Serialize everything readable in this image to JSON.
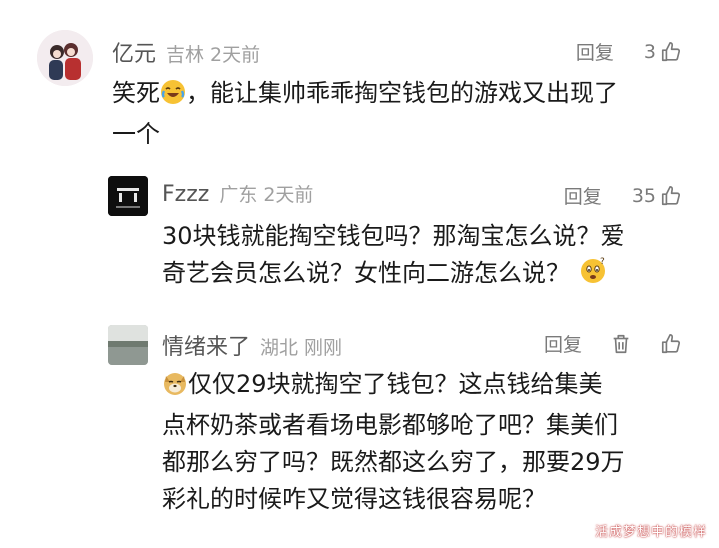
{
  "comments": [
    {
      "username": "亿元",
      "location": "吉林",
      "time": "2天前",
      "reply_label": "回复",
      "likes": "3",
      "text_lines": [
        "笑死",
        "，能让集帅乖乖掏空钱包的游戏又出现了",
        "一个"
      ]
    },
    {
      "username": "Fzzz",
      "location": "广东",
      "time": "2天前",
      "reply_label": "回复",
      "likes": "35",
      "text_lines": [
        "30块钱就能掏空钱包吗？那淘宝怎么说？爱",
        "奇艺会员怎么说？女性向二游怎么说？"
      ]
    },
    {
      "username": "情绪来了",
      "location": "湖北",
      "time": "刚刚",
      "reply_label": "回复",
      "text_lines": [
        "仅仅29块就掏空了钱包？这点钱给集美",
        "点杯奶茶或者看场电影都够呛了吧？集美们",
        "都那么穷了吗？既然都这么穷了，那要29万",
        "彩礼的时候咋又觉得这钱很容易呢？"
      ]
    }
  ],
  "watermark": "活成梦想中的模样",
  "colors": {
    "text": "#1a1a1a",
    "username": "#555555",
    "meta": "#a0a0a0",
    "action": "#7a7a7a"
  },
  "icons": [
    "thumbs-up-icon",
    "trash-icon",
    "laughing-crying-emoji",
    "confused-emoji",
    "doge-emoji"
  ]
}
